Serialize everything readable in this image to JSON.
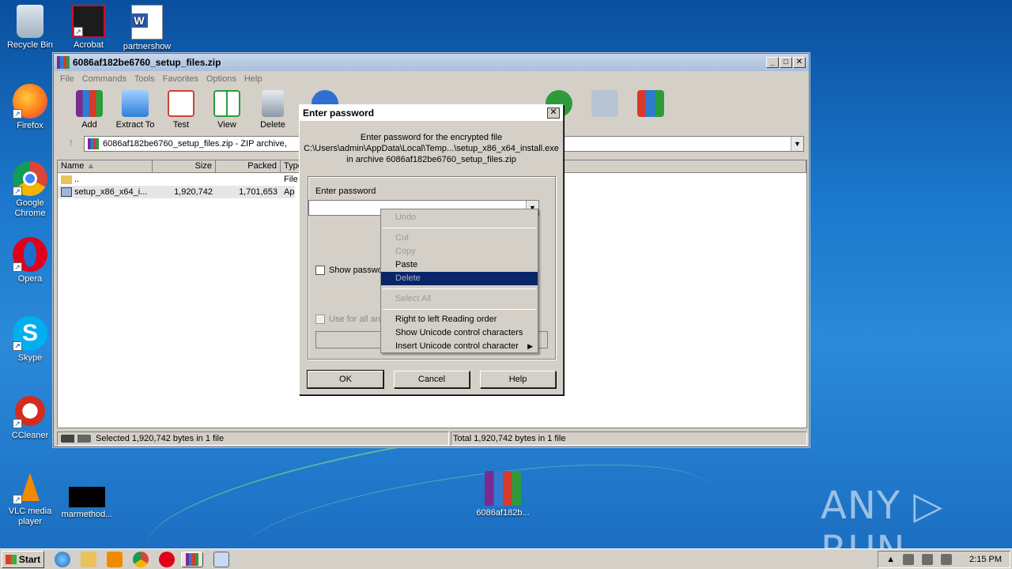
{
  "desktop": {
    "icons": [
      {
        "label": "Recycle Bin"
      },
      {
        "label": "Acrobat"
      },
      {
        "label": "partnershow"
      },
      {
        "label": "Firefox"
      },
      {
        "label": "Google Chrome"
      },
      {
        "label": "Opera"
      },
      {
        "label": "Skype"
      },
      {
        "label": "CCleaner"
      },
      {
        "label": "VLC media player"
      },
      {
        "label": "marmethod..."
      },
      {
        "label": "6086af182b..."
      }
    ],
    "watermark": "ANY ▷ RUN"
  },
  "window": {
    "title": "6086af182be6760_setup_files.zip",
    "menu": [
      "File",
      "Commands",
      "Tools",
      "Favorites",
      "Options",
      "Help"
    ],
    "toolbar": [
      "Add",
      "Extract To",
      "Test",
      "View",
      "Delete"
    ],
    "address": "6086af182be6760_setup_files.zip - ZIP archive,",
    "columns": [
      "Name",
      "Size",
      "Packed",
      "Type"
    ],
    "rows": [
      {
        "name": "..",
        "size": "",
        "packed": "",
        "type": "File f"
      },
      {
        "name": "setup_x86_x64_i...",
        "size": "1,920,742",
        "packed": "1,701,653",
        "type": "Appl"
      }
    ],
    "status_left": "Selected 1,920,742 bytes in 1 file",
    "status_right": "Total 1,920,742 bytes in 1 file"
  },
  "dialog": {
    "title": "Enter password",
    "close": "✕",
    "info_line1": "Enter password for the encrypted file",
    "info_line2": "C:\\Users\\admin\\AppData\\Local\\Temp...\\setup_x86_x64_install.exe",
    "info_line3": "in archive 6086af182be6760_setup_files.zip",
    "group_label": "Enter password",
    "password_value": "",
    "show_password": "Show passwo",
    "use_for_all": "Use for all arc",
    "ok": "OK",
    "cancel": "Cancel",
    "help": "Help"
  },
  "context_menu": {
    "undo": "Undo",
    "cut": "Cut",
    "copy": "Copy",
    "paste": "Paste",
    "delete": "Delete",
    "select_all": "Select All",
    "rtl": "Right to left Reading order",
    "show_unicode": "Show Unicode control characters",
    "insert_unicode": "Insert Unicode control character"
  },
  "taskbar": {
    "start": "Start",
    "clock": "2:15 PM"
  }
}
